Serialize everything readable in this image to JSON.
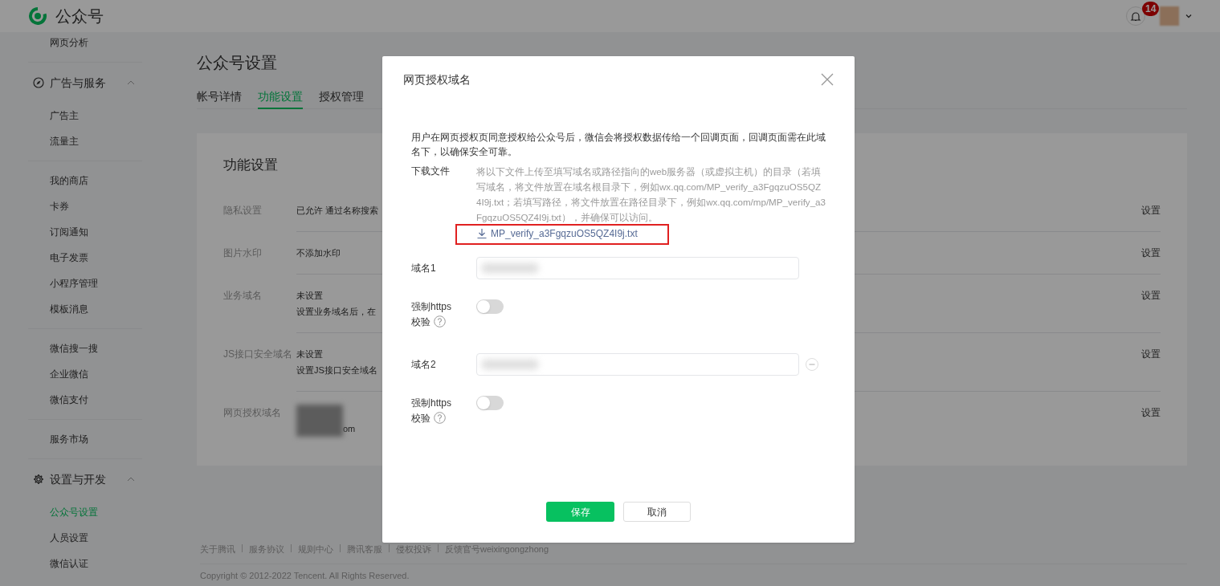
{
  "header": {
    "logo_text": "公众号",
    "notification_count": "14"
  },
  "sidebar": {
    "groups": [
      {
        "items": [
          {
            "label": "网页分析",
            "selected": false
          }
        ]
      },
      {
        "heading": {
          "label": "广告与服务",
          "expanded": true,
          "kind": "compass"
        },
        "items": [
          {
            "label": "广告主",
            "selected": false
          },
          {
            "label": "流量主",
            "selected": false
          }
        ]
      },
      {
        "items": [
          {
            "label": "我的商店",
            "selected": false
          },
          {
            "label": "卡券",
            "selected": false
          },
          {
            "label": "订阅通知",
            "selected": false
          },
          {
            "label": "电子发票",
            "selected": false
          },
          {
            "label": "小程序管理",
            "selected": false
          },
          {
            "label": "模板消息",
            "selected": false
          }
        ]
      },
      {
        "items": [
          {
            "label": "微信搜一搜",
            "selected": false
          },
          {
            "label": "企业微信",
            "selected": false
          },
          {
            "label": "微信支付",
            "selected": false
          }
        ]
      },
      {
        "items": [
          {
            "label": "服务市场",
            "selected": false
          }
        ]
      },
      {
        "heading": {
          "label": "设置与开发",
          "expanded": true,
          "kind": "gear"
        },
        "items": [
          {
            "label": "公众号设置",
            "selected": true
          },
          {
            "label": "人员设置",
            "selected": false
          },
          {
            "label": "微信认证",
            "selected": false
          }
        ]
      }
    ]
  },
  "page_title": "公众号设置",
  "tabs": [
    {
      "label": "帐号详情",
      "selected": false
    },
    {
      "label": "功能设置",
      "selected": true
    },
    {
      "label": "授权管理",
      "selected": false
    }
  ],
  "card": {
    "title": "功能设置",
    "rows": [
      {
        "label": "隐私设置",
        "value_lines": [
          "已允许 通过名称搜索"
        ],
        "redacted": false,
        "action": "设置"
      },
      {
        "label": "图片水印",
        "value_lines": [
          "不添加水印"
        ],
        "redacted": false,
        "action": "设置"
      },
      {
        "label": "业务域名",
        "value_lines": [
          "未设置",
          "设置业务域名后，在"
        ],
        "redacted": false,
        "action": "设置"
      },
      {
        "label": "JS接口安全域名",
        "value_lines": [
          "未设置",
          "设置JS接口安全域名"
        ],
        "redacted": false,
        "action": "设置"
      },
      {
        "label": "网页授权域名",
        "value_lines": [
          "om"
        ],
        "redacted": true,
        "action": "设置"
      }
    ]
  },
  "footer": {
    "links": [
      "关于腾讯",
      "服务协议",
      "规则中心",
      "腾讯客服",
      "侵权投诉",
      "反馈官号weixingongzhong"
    ],
    "copyright": "Copyright © 2012-2022 Tencent. All Rights Reserved."
  },
  "modal": {
    "title": "网页授权域名",
    "description": "用户在网页授权页同意授权给公众号后，微信会将授权数据传给一个回调页面，回调页面需在此域名下，以确保安全可靠。",
    "download": {
      "label": "下载文件",
      "hint": "将以下文件上传至填写域名或路径指向的web服务器（或虚拟主机）的目录（若填写域名，将文件放置在域名根目录下，例如wx.qq.com/MP_verify_a3FgqzuOS5QZ4I9j.txt；若填写路径，将文件放置在路径目录下，例如wx.qq.com/mp/MP_verify_a3FgqzuOS5QZ4I9j.txt），并确保可以访问。",
      "file": "MP_verify_a3FgqzuOS5QZ4I9j.txt",
      "highlighted": true
    },
    "fields": [
      {
        "kind": "domain",
        "label": "域名1",
        "redacted": true,
        "removable": false
      },
      {
        "kind": "switch",
        "label_lines": [
          "强制https",
          "校验"
        ],
        "on": false
      },
      {
        "kind": "domain",
        "label": "域名2",
        "redacted": true,
        "removable": true
      },
      {
        "kind": "switch",
        "label_lines": [
          "强制https",
          "校验"
        ],
        "on": false
      }
    ],
    "buttons": [
      {
        "kind": "primary",
        "label": "保存"
      },
      {
        "kind": "secondary",
        "label": "取消"
      }
    ]
  }
}
